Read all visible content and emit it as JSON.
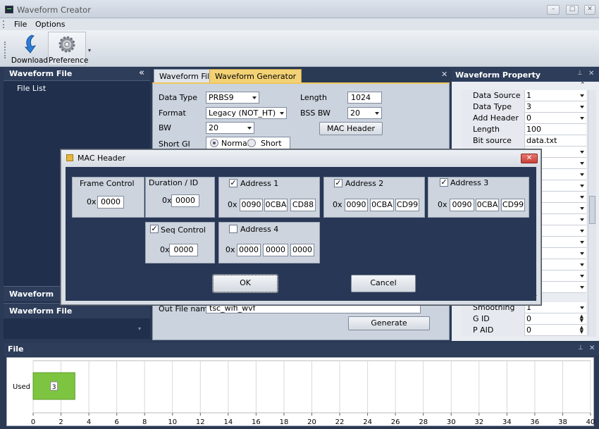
{
  "app": {
    "title": "Waveform Creator"
  },
  "menu": {
    "file": "File",
    "options": "Options"
  },
  "toolbar": {
    "download": "Download",
    "preference": "Preference"
  },
  "left_panel": {
    "title": "Waveform File",
    "file_list": "File List",
    "section1": "Waveform",
    "section2": "Waveform File"
  },
  "center": {
    "tabs": [
      "Waveform File",
      "Waveform Generator"
    ],
    "active_tab": "Waveform Generator",
    "data_type_label": "Data Type",
    "data_type_value": "PRBS9",
    "format_label": "Format",
    "format_value": "Legacy (NOT_HT)",
    "bw_label": "BW",
    "bw_value": "20",
    "short_gi_label": "Short GI",
    "short_gi_normal": "Normal",
    "short_gi_short": "Short",
    "length_label": "Length",
    "length_value": "1024",
    "bss_bw_label": "BSS BW",
    "bss_bw_value": "20",
    "mac_header_button": "MAC Header",
    "out_file_label": "Out File name",
    "out_file_value": "tsc_wifi_wvf",
    "generate_button": "Generate"
  },
  "right_panel": {
    "title": "Waveform Property",
    "rows_top": [
      {
        "key": "Data Source",
        "value": "1",
        "ctl": "dd"
      },
      {
        "key": "Data Type",
        "value": "3",
        "ctl": "dd"
      },
      {
        "key": "Add Header",
        "value": "0",
        "ctl": "dd"
      },
      {
        "key": "Length",
        "value": "100",
        "ctl": ""
      },
      {
        "key": "Bit source",
        "value": "data.txt",
        "ctl": ""
      }
    ],
    "rows_bottom": [
      {
        "key": "Smoothing",
        "value": "1",
        "ctl": "dd"
      },
      {
        "key": "G ID",
        "value": "0",
        "ctl": "sp"
      },
      {
        "key": "P AID",
        "value": "0",
        "ctl": "sp"
      }
    ]
  },
  "dialog": {
    "title": "MAC Header",
    "prefix": "0x",
    "frame_control": {
      "label": "Frame Control",
      "value": "0000"
    },
    "duration_id": {
      "label": "Duration / ID",
      "value": "0000"
    },
    "address1": {
      "label": "Address 1",
      "checked": true,
      "values": [
        "0090",
        "0CBA",
        "CD88"
      ]
    },
    "address2": {
      "label": "Address 2",
      "checked": true,
      "values": [
        "0090",
        "0CBA",
        "CD99"
      ]
    },
    "address3": {
      "label": "Address 3",
      "checked": true,
      "values": [
        "0090",
        "0CBA",
        "CD99"
      ]
    },
    "seq_control": {
      "label": "Seq Control",
      "checked": true,
      "value": "0000"
    },
    "address4": {
      "label": "Address 4",
      "checked": false,
      "values": [
        "0000",
        "0000",
        "0000"
      ]
    },
    "ok": "OK",
    "cancel": "Cancel"
  },
  "file_panel": {
    "title": "File"
  },
  "chart_data": {
    "type": "bar",
    "orientation": "horizontal",
    "categories": [
      "Used"
    ],
    "values": [
      3
    ],
    "data_labels": [
      "3"
    ],
    "xlim": [
      0,
      40
    ],
    "xticks": [
      0,
      2,
      4,
      6,
      8,
      10,
      12,
      14,
      16,
      18,
      20,
      22,
      24,
      26,
      28,
      30,
      32,
      34,
      36,
      38,
      40
    ],
    "bar_color": "#7dc540",
    "grid": true
  }
}
